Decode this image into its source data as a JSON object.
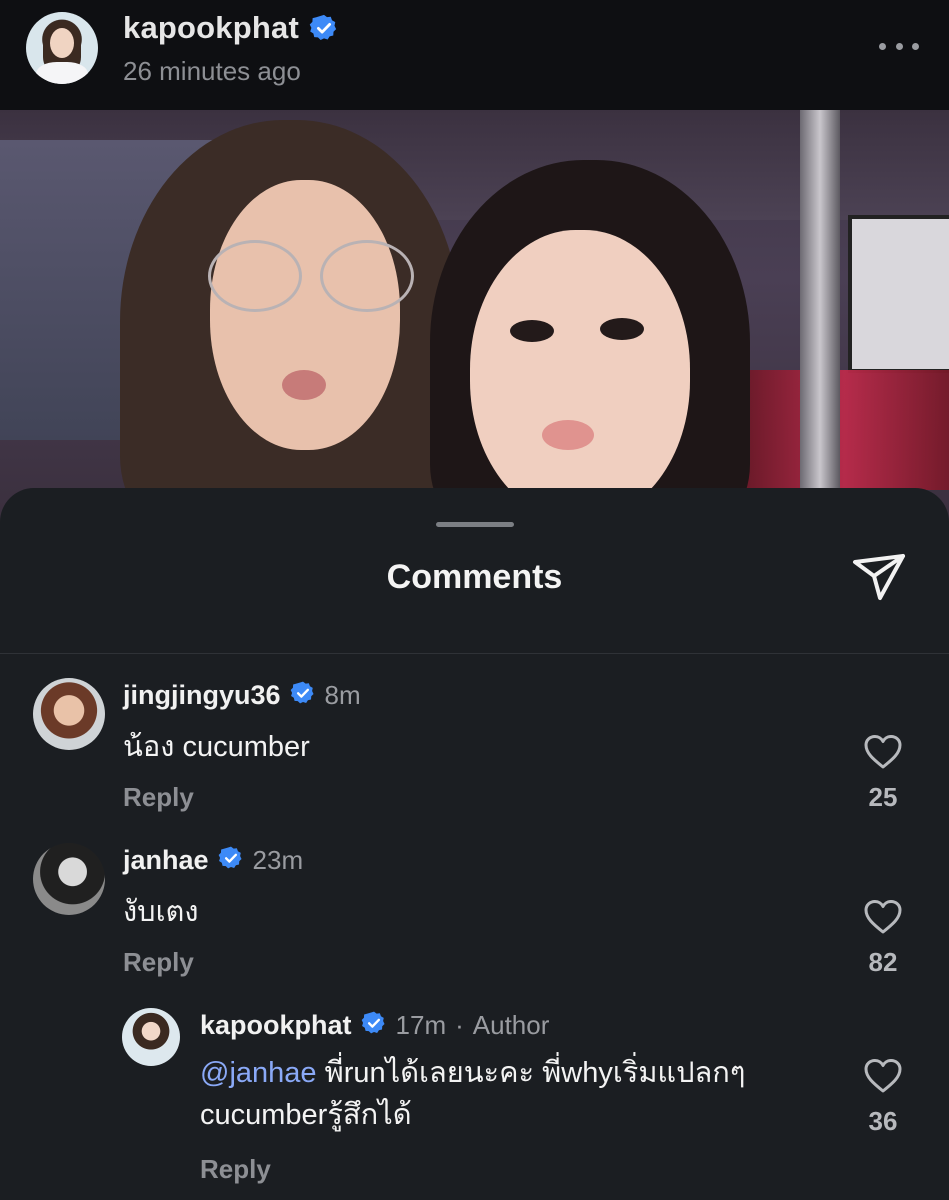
{
  "post": {
    "username": "kapookphat",
    "time": "26 minutes ago"
  },
  "sheet": {
    "title": "Comments"
  },
  "comments": [
    {
      "username": "jingjingyu36",
      "verified": true,
      "time": "8m",
      "text": "น้อง cucumber",
      "reply_label": "Reply",
      "likes": "25"
    },
    {
      "username": "janhae",
      "verified": true,
      "time": "23m",
      "text": "งับเตง",
      "reply_label": "Reply",
      "likes": "82"
    }
  ],
  "reply": {
    "username": "kapookphat",
    "verified": true,
    "time": "17m",
    "separator": "·",
    "author_label": "Author",
    "mention": "@janhae",
    "text_line1": " พี่runได้เลยนะคะ พี่whyเริ่มแปลกๆ",
    "text_line2": "cucumberรู้สึกได้",
    "reply_label": "Reply",
    "likes": "36"
  },
  "colors": {
    "verified_badge": "#3d8af7",
    "mention": "#8aa9f7",
    "sheet_bg": "#1b1e22"
  },
  "icons": {
    "more": "more-icon",
    "share": "send-icon",
    "like": "heart-icon",
    "verified": "verified-badge-icon"
  }
}
